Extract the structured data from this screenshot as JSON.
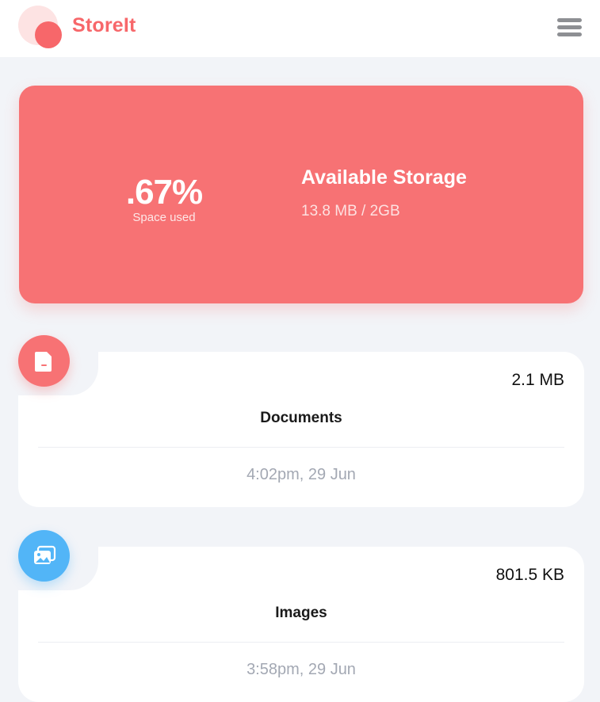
{
  "header": {
    "brand": "StoreIt",
    "menu_icon": "hamburger-menu-icon"
  },
  "storage": {
    "percent": ".67%",
    "percent_label": "Space used",
    "title": "Available Storage",
    "usage": "13.8 MB / 2GB"
  },
  "files": [
    {
      "type": "Documents",
      "size": "2.1 MB",
      "date": "4:02pm, 29 Jun",
      "icon": "document-icon",
      "color": "#f77274"
    },
    {
      "type": "Images",
      "size": "801.5 KB",
      "date": "3:58pm, 29 Jun",
      "icon": "images-icon",
      "color": "#52b5f7"
    }
  ],
  "colors": {
    "accent": "#f77274",
    "images": "#52b5f7",
    "background": "#f2f4f8"
  }
}
